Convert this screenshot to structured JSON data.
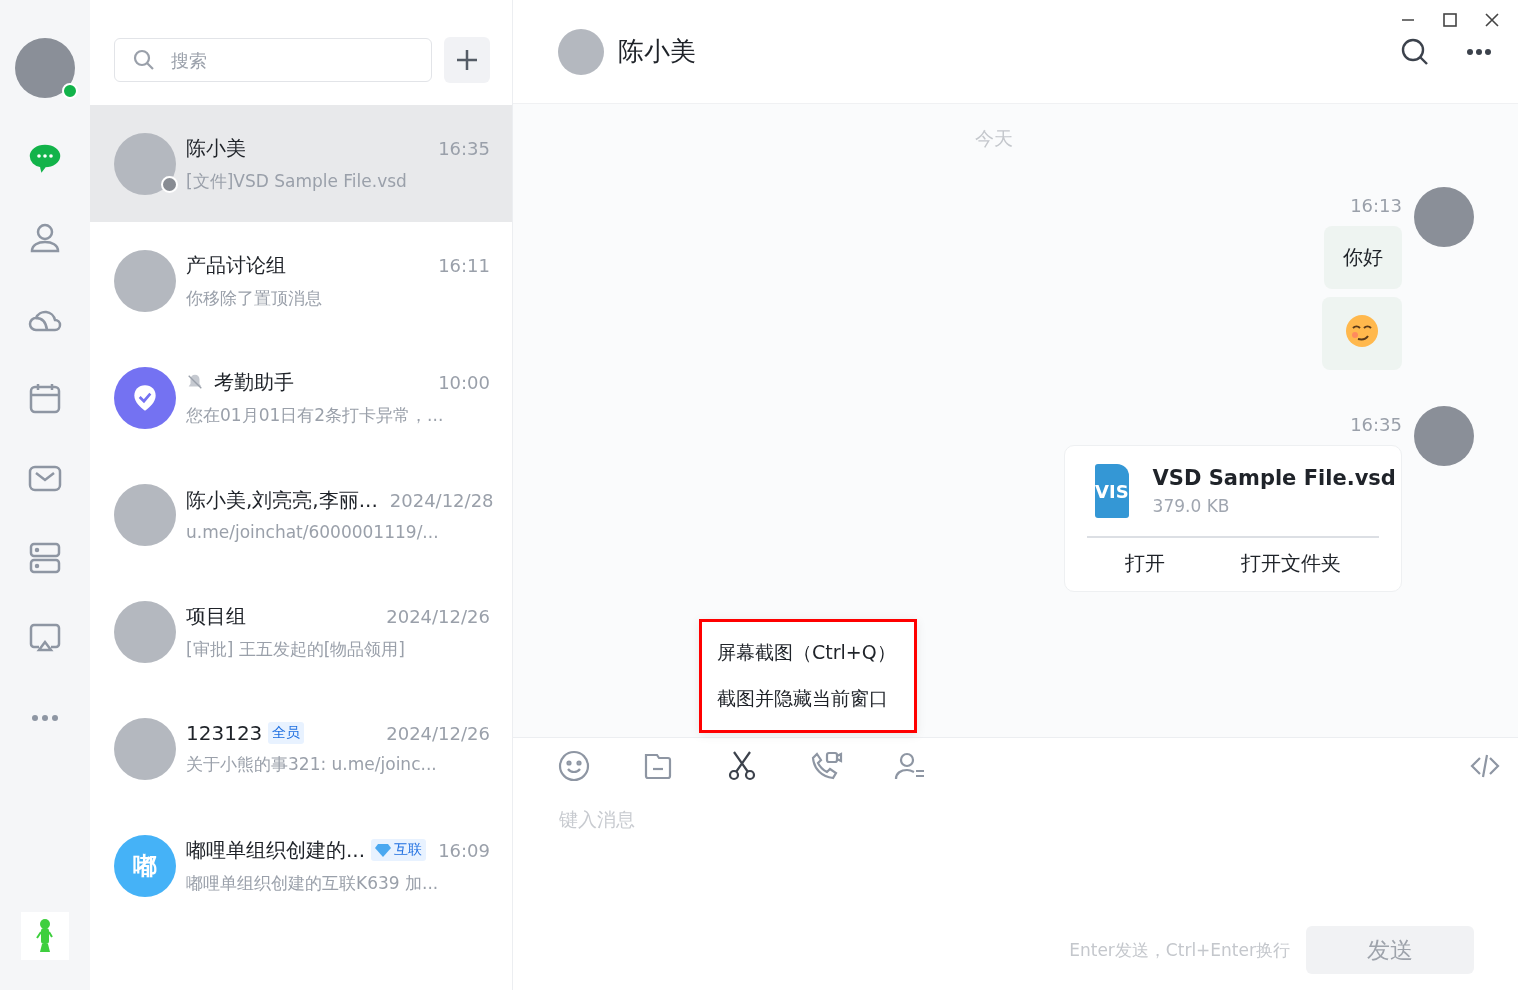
{
  "rail": {
    "user": {
      "online": true
    },
    "nav": [
      {
        "selected": true
      },
      {
        "selected": false
      },
      {
        "selected": false
      },
      {
        "selected": false
      },
      {
        "selected": false
      },
      {
        "selected": false
      },
      {
        "selected": false
      },
      {
        "selected": false
      }
    ]
  },
  "search": {
    "placeholder": "搜索"
  },
  "chats": [
    {
      "name": "陈小美",
      "time": "16:35",
      "preview": "[文件]VSD Sample File.vsd",
      "selected": true,
      "avatar": {
        "kind": "photo"
      },
      "status_dot": true,
      "muted": false
    },
    {
      "name": "产品讨论组",
      "time": "16:11",
      "preview": "你移除了置顶消息",
      "selected": false,
      "avatar": {
        "kind": "photo"
      },
      "status_dot": false,
      "muted": false
    },
    {
      "name": "考勤助手",
      "time": "10:00",
      "preview": "您在01月01日有2条打卡异常，...",
      "selected": false,
      "avatar": {
        "kind": "badge"
      },
      "status_dot": false,
      "muted": true
    },
    {
      "name": "陈小美,刘亮亮,李丽...",
      "time": "2024/12/28",
      "preview": "u.me/joinchat/6000001119/...",
      "selected": false,
      "avatar": {
        "kind": "photo"
      },
      "status_dot": false,
      "muted": false
    },
    {
      "name": "项目组",
      "time": "2024/12/26",
      "preview": "[审批] 王五发起的[物品领用]",
      "selected": false,
      "avatar": {
        "kind": "photo"
      },
      "status_dot": false,
      "muted": false
    },
    {
      "name": "123123",
      "time": "2024/12/26",
      "preview": "关于小熊的事321: u.me/joinc...",
      "selected": false,
      "avatar": {
        "kind": "photo"
      },
      "status_dot": false,
      "muted": false,
      "tag": {
        "text": "全员",
        "kind": "plain"
      }
    },
    {
      "name": "嘟哩单组织创建的...",
      "time": "16:09",
      "preview": "嘟哩单组织创建的互联K639 加...",
      "selected": false,
      "avatar": {
        "kind": "text",
        "text": "嘟"
      },
      "status_dot": false,
      "muted": false,
      "tag": {
        "text": "互联",
        "kind": "linked"
      }
    }
  ],
  "conversation": {
    "title": "陈小美",
    "date_divider": "今天",
    "messages": [
      {
        "kind": "text",
        "time": "16:13",
        "text": "你好"
      },
      {
        "kind": "emoji"
      },
      {
        "kind": "file",
        "time": "16:35",
        "file_name": "VSD Sample File.vsd",
        "file_type": "VIS",
        "size": "379.0 KB",
        "actions": [
          "打开",
          "打开文件夹"
        ]
      }
    ]
  },
  "context_menu": {
    "highlighted": true,
    "items": [
      "屏幕截图（Ctrl+Q）",
      "截图并隐藏当前窗口"
    ]
  },
  "composer": {
    "tools": [
      {
        "active": false
      },
      {
        "active": false
      },
      {
        "active": true
      },
      {
        "active": false
      },
      {
        "active": false
      },
      {
        "active": false
      }
    ],
    "placeholder": "键入消息",
    "hint": "Enter发送，Ctrl+Enter换行",
    "send": {
      "label": "发送",
      "disabled": true
    }
  }
}
